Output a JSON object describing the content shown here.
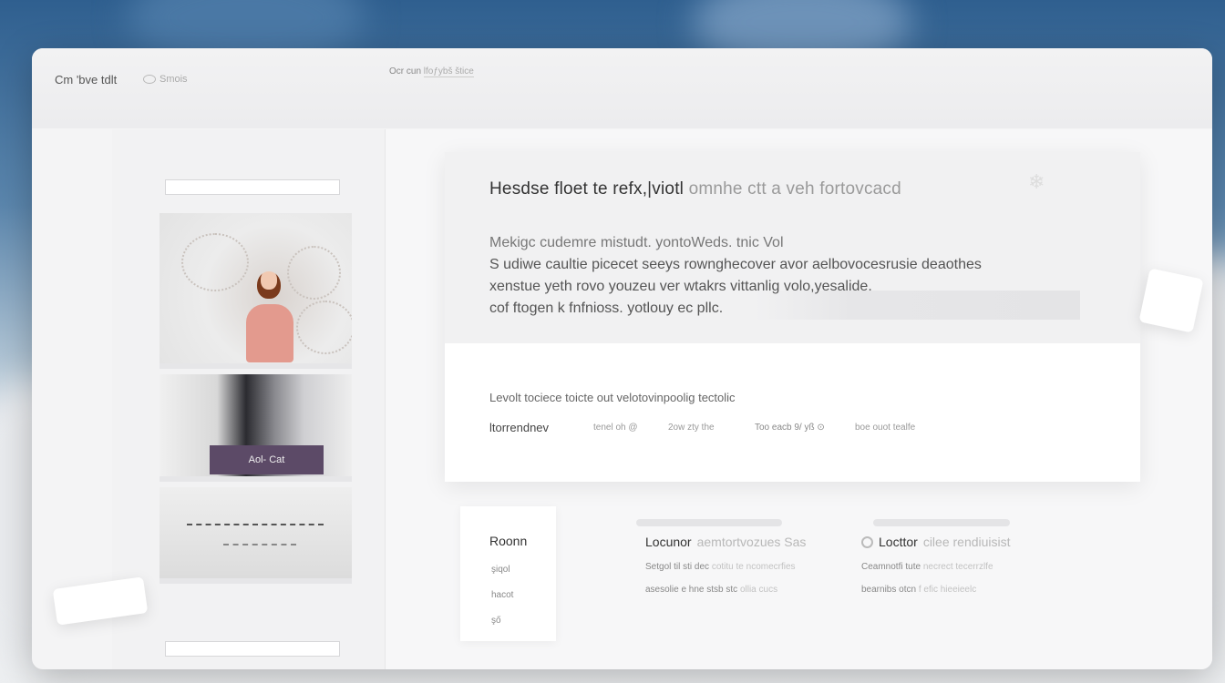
{
  "header": {
    "brand": "Cm 'bve tdlt",
    "brand_sub": "Smois",
    "nav_link_prefix": "Ocr cun",
    "nav_link_underlined": "lfoƒybš štice"
  },
  "sidebar": {
    "thumb_overlay_label": "Aol- Cat"
  },
  "hero_card": {
    "title": "Hesdse floet te refx,|viotl",
    "title_faded": "omnhe ctt a veh  fortovcacd",
    "paragraph": [
      "Mekigc cudemre mistudt. yontoWeds. tnic Vol",
      "S udiwe caultie picecet seeys rownghecover avor aelbovocesrusie deaothes",
      "xenstue yeth rovo youzeu ver wtakrs vittanlig volo,yesalide.",
      "cof ftogen k fnfnioss.  yotlouy ec pllc."
    ],
    "subtitle": "Levolt tociece toicte out velotovinpoolig tectolic",
    "meta": {
      "label": "ltorrendnev",
      "a": "tenel oh @",
      "b": "2ow zty the",
      "c": "Too eacb 9/ yß ⊙",
      "d": "boe ouot tealfe"
    }
  },
  "lower": {
    "left_card": {
      "title": "Roonn",
      "items": [
        "şiqol",
        "hacot",
        "şő"
      ]
    },
    "col1": {
      "title": "Locunor",
      "title_faded": "aemtortvozues  Sas",
      "line1": "Setgol til sti dec",
      "line1_faded": "cotitu te ncomecrfies",
      "line2": "asesolie e hne stsb stc",
      "line2_faded": "ollia cucs"
    },
    "col2": {
      "title": "Locttor",
      "title_faded": "cilee rendiuisist",
      "line1": "Ceamnotfi tute",
      "line1_faded": "necrect tecerrzlfe",
      "line2": "bearnibs otcn",
      "line2_faded": "f efic hieeieelc"
    }
  },
  "colors": {
    "overlay_accent": "#5c4a67",
    "background_top": "#2f5f8f"
  }
}
